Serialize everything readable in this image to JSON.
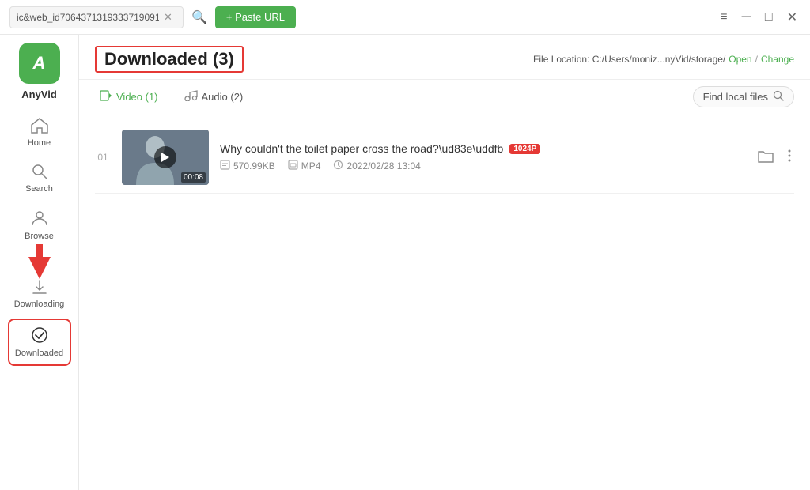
{
  "titlebar": {
    "url_text": "ic&web_id70643713193337190917",
    "close_icon": "✕",
    "search_icon": "🔍",
    "paste_url_label": "+ Paste URL",
    "menu_icon": "≡",
    "minimize_icon": "─",
    "maximize_icon": "□",
    "window_close_icon": "✕"
  },
  "app": {
    "logo_letter": "A",
    "name": "AnyVid"
  },
  "sidebar": {
    "items": [
      {
        "id": "home",
        "icon": "🏠",
        "label": "Home",
        "active": false
      },
      {
        "id": "search",
        "icon": "🔍",
        "label": "Search",
        "active": false
      },
      {
        "id": "browse",
        "icon": "👤",
        "label": "Browse",
        "active": false
      },
      {
        "id": "downloading",
        "icon": "⬇",
        "label": "Downloading",
        "active": false
      },
      {
        "id": "downloaded",
        "icon": "✓",
        "label": "Downloaded",
        "active": true
      }
    ]
  },
  "content": {
    "header": {
      "title": "Downloaded (3)",
      "file_location_label": "File Location: C:/Users/moniz...nyVid/storage/",
      "open_label": "Open",
      "separator": "/",
      "change_label": "Change"
    },
    "tabs": [
      {
        "id": "video",
        "icon": "▦",
        "label": "Video (1)",
        "active": true
      },
      {
        "id": "audio",
        "icon": "🎧",
        "label": "Audio (2)",
        "active": false
      }
    ],
    "find_local": {
      "label": "Find local files",
      "icon": "🔍"
    },
    "videos": [
      {
        "index": "01",
        "title": "Why couldn't the toilet paper cross the road?\\ud83e\\uddfb",
        "quality": "1024P",
        "duration": "00:08",
        "file_size": "570.99KB",
        "format": "MP4",
        "date": "2022/02/28 13:04"
      }
    ]
  }
}
